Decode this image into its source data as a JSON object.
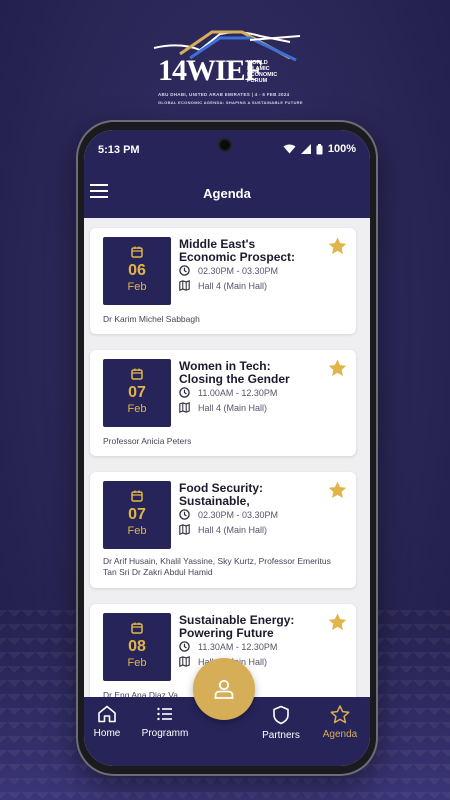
{
  "promo": {
    "logo_number": "14",
    "logo_wordmark": "WIEF",
    "logo_org": [
      "WORLD",
      "ISLAMIC",
      "ECONOMIC",
      "FORUM"
    ],
    "logo_location": "ABU DHABI, UNITED ARAB EMIRATES | 4 - 6 FEB 2024",
    "logo_tagline": "GLOBAL ECONOMIC AGENDA: SHAPING A SUSTAINABLE FUTURE"
  },
  "status": {
    "time": "5:13 PM",
    "battery": "100%"
  },
  "appbar": {
    "title": "Agenda",
    "menu_icon": "hamburger-menu-icon"
  },
  "colors": {
    "navy": "#27245a",
    "gold": "#e2b54a",
    "fab": "#d6ae58",
    "bg": "#efeff2"
  },
  "sessions": [
    {
      "day": "06",
      "month": "Feb",
      "title": "Middle East's\nEconomic Prospect:",
      "time": "02.30PM - 03.30PM",
      "venue": "Hall 4 (Main Hall)",
      "speakers": "Dr Karim Michel Sabbagh",
      "starred": true
    },
    {
      "day": "07",
      "month": "Feb",
      "title": "Women in Tech:\nClosing the Gender",
      "time": "11.00AM - 12.30PM",
      "venue": "Hall 4 (Main Hall)",
      "speakers": "Professor Anicia Peters",
      "starred": true
    },
    {
      "day": "07",
      "month": "Feb",
      "title": "Food Security:\nSustainable,",
      "time": "02.30PM - 03.30PM",
      "venue": "Hall 4 (Main Hall)",
      "speakers": "Dr Arif Husain, Khalil Yassine, Sky Kurtz, Professor Emeritus Tan Sri Dr Zakri Abdul Hamid",
      "starred": true
    },
    {
      "day": "08",
      "month": "Feb",
      "title": "Sustainable Energy:\nPowering Future",
      "time": "11.30AM - 12.30PM",
      "venue": "Hall 4 (Main Hall)",
      "speakers": "Dr Eng Ana Diaz Va",
      "starred": true
    }
  ],
  "nav": {
    "home": "Home",
    "programme": "Programm",
    "partners": "Partners",
    "agenda": "Agenda",
    "active": "agenda"
  }
}
